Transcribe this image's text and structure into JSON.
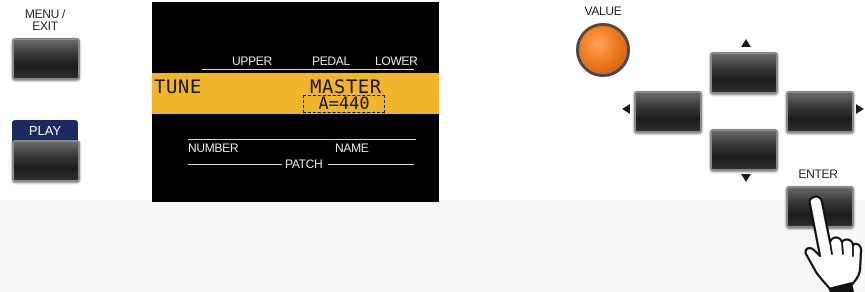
{
  "left_panel": {
    "menu_exit_label_line1": "MENU /",
    "menu_exit_label_line2": "EXIT",
    "play_label": "PLAY"
  },
  "display": {
    "section_labels": [
      "UPPER",
      "PEDAL",
      "LOWER"
    ],
    "left_text": "TUNE",
    "title": "MASTER",
    "value": "A=440",
    "number_label": "NUMBER",
    "name_label": "NAME",
    "patch_label": "PATCH"
  },
  "right_panel": {
    "value_label": "VALUE",
    "enter_label": "ENTER"
  },
  "colors": {
    "lcd_highlight": "#f0b52a",
    "value_knob": "#f07a1e",
    "play_tab": "#1a2a5e"
  },
  "icons": [
    "arrow-up-icon",
    "arrow-down-icon",
    "arrow-left-icon",
    "arrow-right-icon",
    "pointing-hand-icon"
  ]
}
